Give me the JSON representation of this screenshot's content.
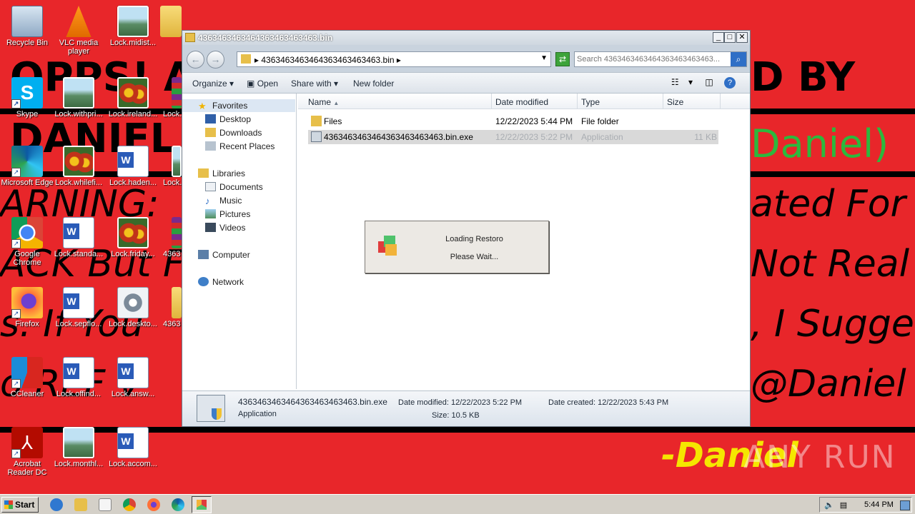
{
  "wallpaper": {
    "line1": "OPPS! A",
    "line1b": "D BY",
    "line2": "DANIEL",
    "line2b": "Daniel)",
    "line3": "ARNING:",
    "line3b": "ated For",
    "line4": "ACK But F",
    "line4b": "Not Real",
    "line5": "s. If You",
    "line5b": ", I Sugge",
    "line6": "o REF V",
    "line6b": "@Daniel",
    "line7": "-Daniel",
    "watermark": "ANY RUN"
  },
  "desktop_icons": [
    {
      "label": "Recycle Bin"
    },
    {
      "label": "VLC media player"
    },
    {
      "label": "Lock.midist..."
    },
    {
      "label": "Skype"
    },
    {
      "label": "Lock.withpri..."
    },
    {
      "label": "Lock.ireland..."
    },
    {
      "label": "Lock."
    },
    {
      "label": "Microsoft Edge"
    },
    {
      "label": "Lock.whilefi..."
    },
    {
      "label": "Lock.haden..."
    },
    {
      "label": "Lock."
    },
    {
      "label": "Google Chrome"
    },
    {
      "label": "Lock.standa..."
    },
    {
      "label": "Lock.friday..."
    },
    {
      "label": "4363"
    },
    {
      "label": "Firefox"
    },
    {
      "label": "Lock.sepflo..."
    },
    {
      "label": "Lock.deskto..."
    },
    {
      "label": "4363"
    },
    {
      "label": "CCleaner"
    },
    {
      "label": "Lock.offind..."
    },
    {
      "label": "Lock.answ..."
    },
    {
      "label": "Acrobat Reader DC"
    },
    {
      "label": "Lock.monthl..."
    },
    {
      "label": "Lock.accom..."
    }
  ],
  "explorer": {
    "title": "43634634634643634634634 63.bin",
    "title_text": "4363463463464363463463463.bin",
    "window_buttons": {
      "minimize": "_",
      "maximize": "□",
      "close": "✕"
    },
    "address": "4363463463464363463463463.bin",
    "address_prefix": "▸",
    "search_placeholder": "Search 4363463463464363463463463...",
    "toolbar": {
      "organize": "Organize",
      "open": "Open",
      "share_with": "Share with",
      "new_folder": "New folder"
    },
    "nav": {
      "favorites": "Favorites",
      "desktop": "Desktop",
      "downloads": "Downloads",
      "recent_places": "Recent Places",
      "libraries": "Libraries",
      "documents": "Documents",
      "music": "Music",
      "pictures": "Pictures",
      "videos": "Videos",
      "computer": "Computer",
      "network": "Network"
    },
    "columns": {
      "name": "Name",
      "date_modified": "Date modified",
      "type": "Type",
      "size": "Size"
    },
    "files": [
      {
        "name": "Files",
        "date": "12/22/2023 5:44 PM",
        "type": "File folder",
        "size": ""
      },
      {
        "name": "4363463463464363463463463.bin.exe",
        "date": "12/22/2023 5:22 PM",
        "type": "Application",
        "size": "11 KB"
      }
    ],
    "details": {
      "filename": "4363463463464363463463463.bin.exe",
      "filetype": "Application",
      "date_modified_label": "Date modified:",
      "date_modified": "12/22/2023 5:22 PM",
      "date_created_label": "Date created:",
      "date_created": "12/22/2023 5:43 PM",
      "size_label": "Size:",
      "size": "10.5 KB"
    }
  },
  "loading_dialog": {
    "line1": "Loading Restoro",
    "line2": "Please Wait..."
  },
  "taskbar": {
    "start": "Start",
    "clock": "5:44 PM"
  },
  "colors": {
    "wallpaper_red": "#e8262a",
    "selection_gray": "#d9d9d9",
    "taskbar": "#d4d0c8"
  }
}
